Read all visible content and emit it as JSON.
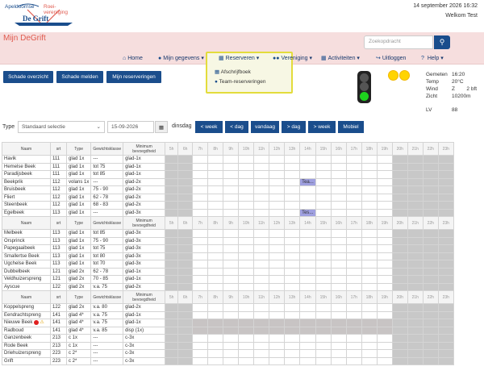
{
  "header": {
    "logo_text_1": "Apeldoornse",
    "logo_text_2": "Roei-",
    "logo_text_3": "vereniging",
    "logo_text_4": "De Grift",
    "datetime": "14 september 2026 16:32",
    "welcome": "Welkom Test"
  },
  "site": {
    "title": "Mijn DeGrift",
    "search_placeholder": "Zoekopdracht"
  },
  "nav": {
    "home": "Home",
    "mijn_gegevens": "Mijn gegevens",
    "reserveren": "Reserveren",
    "vereniging": "Vereniging",
    "activiteiten": "Activiteiten",
    "uitloggen": "Uitloggen",
    "help": "Help"
  },
  "dropdown": {
    "items": [
      "Afschrijfboek",
      "Team-reserveringen"
    ]
  },
  "actions": {
    "schade_overzicht": "Schade overzicht",
    "schade_melden": "Schade melden",
    "mijn_reserveringen": "Mijn reserveringen"
  },
  "weather": {
    "gemeten_label": "Gemeten",
    "gemeten_value": "16:20",
    "temp_label": "Temp",
    "temp_value": "20°C",
    "wind_label": "Wind",
    "wind_value": "Z        2 bft",
    "zicht_label": "Zicht",
    "zicht_value": "10200m",
    "lv_label": "LV",
    "lv_value": "88"
  },
  "filters": {
    "type_label": "Type",
    "type_value": "Standaard selectie",
    "date_value": "15-09-2026",
    "day_label": "dinsdag",
    "buttons": [
      "< week",
      "< dag",
      "vandaag",
      "> dag",
      "> week",
      "Mobiel"
    ]
  },
  "table": {
    "headers": [
      "Naam",
      "srt",
      "Type",
      "Gewichtsklasse",
      "Minimum bevoegdheid"
    ],
    "hours": [
      "5h",
      "6h",
      "7h",
      "8h",
      "9h",
      "10h",
      "11h",
      "12h",
      "13h",
      "14h",
      "15h",
      "16h",
      "17h",
      "18h",
      "19h",
      "20h",
      "21h",
      "22h",
      "23h"
    ],
    "rows": [
      {
        "name": "Havik",
        "srt": "111",
        "type": "glad 1x",
        "gew": "---",
        "bev": "glad-1x"
      },
      {
        "name": "Hemelse Beek",
        "srt": "111",
        "type": "glad 1x",
        "gew": "tot 75",
        "bev": "glad-1x"
      },
      {
        "name": "Paradijsbeek",
        "srt": "111",
        "type": "glad 1x",
        "gew": "tot 85",
        "bev": "glad-1x"
      },
      {
        "name": "Beekprik",
        "srt": "112",
        "type": "volans 1x",
        "gew": "---",
        "bev": "glad-2x",
        "res_label": "Tea..."
      },
      {
        "name": "Bruisbeek",
        "srt": "112",
        "type": "glad 1x",
        "gew": "75 - 90",
        "bev": "glad-2x"
      },
      {
        "name": "Fliert",
        "srt": "112",
        "type": "glad 1x",
        "gew": "62 - 78",
        "bev": "glad-2x"
      },
      {
        "name": "Steenbeek",
        "srt": "112",
        "type": "glad 1x",
        "gew": "68 - 83",
        "bev": "glad-2x"
      },
      {
        "name": "Egelbeek",
        "srt": "113",
        "type": "glad 1x",
        "gew": "---",
        "bev": "glad-3x",
        "res_label": "Tes..."
      },
      {
        "name": "Melbeek",
        "srt": "113",
        "type": "glad 1x",
        "gew": "tot 85",
        "bev": "glad-3x"
      },
      {
        "name": "Orsprinck",
        "srt": "113",
        "type": "glad 1x",
        "gew": "75 - 90",
        "bev": "glad-3x"
      },
      {
        "name": "Papegaaibeek",
        "srt": "113",
        "type": "glad 1x",
        "gew": "tot 75",
        "bev": "glad-3x"
      },
      {
        "name": "Smallertse Beek",
        "srt": "113",
        "type": "glad 1x",
        "gew": "tot 80",
        "bev": "glad-3x"
      },
      {
        "name": "Ugchelse Beek",
        "srt": "113",
        "type": "glad 1x",
        "gew": "tot 70",
        "bev": "glad-3x"
      },
      {
        "name": "Dubbelbeek",
        "srt": "121",
        "type": "glad 2x",
        "gew": "62 - 78",
        "bev": "glad-1x"
      },
      {
        "name": "Veldhuizerspreng",
        "srt": "121",
        "type": "glad 2x",
        "gew": "70 - 85",
        "bev": "glad-1x"
      },
      {
        "name": "Ayscue",
        "srt": "122",
        "type": "glad 2x",
        "gew": "v.a. 75",
        "bev": "glad-2x"
      },
      {
        "name": "Koppelspreng",
        "srt": "122",
        "type": "glad 2x",
        "gew": "v.a. 80",
        "bev": "glad-2x"
      },
      {
        "name": "Eendrachtspreng",
        "srt": "141",
        "type": "glad 4*",
        "gew": "v.a. 75",
        "bev": "glad-1x"
      },
      {
        "name": "Nieuwe Beek",
        "srt": "141",
        "type": "glad 4*",
        "gew": "v.a. 75",
        "bev": "glad-1x"
      },
      {
        "name": "Radboud",
        "srt": "141",
        "type": "glad 4*",
        "gew": "v.a. 85",
        "bev": "disp (1x)"
      },
      {
        "name": "Ganzenbeek",
        "srt": "213",
        "type": "c 1x",
        "gew": "---",
        "bev": "c-3x"
      },
      {
        "name": "Rode Beek",
        "srt": "213",
        "type": "c 1x",
        "gew": "---",
        "bev": "c-3x"
      },
      {
        "name": "Driehuizerspreng",
        "srt": "223",
        "type": "c 2*",
        "gew": "---",
        "bev": "c-3x"
      },
      {
        "name": "Grift",
        "srt": "223",
        "type": "c 2*",
        "gew": "---",
        "bev": "c-3x"
      }
    ]
  },
  "colors": {
    "brand_blue": "#1a4d8c",
    "title_red": "#e05a4e",
    "header_pink": "#f6dede",
    "highlight_yellow": "#e3dc3c",
    "reservation": "#9fa0e0"
  }
}
